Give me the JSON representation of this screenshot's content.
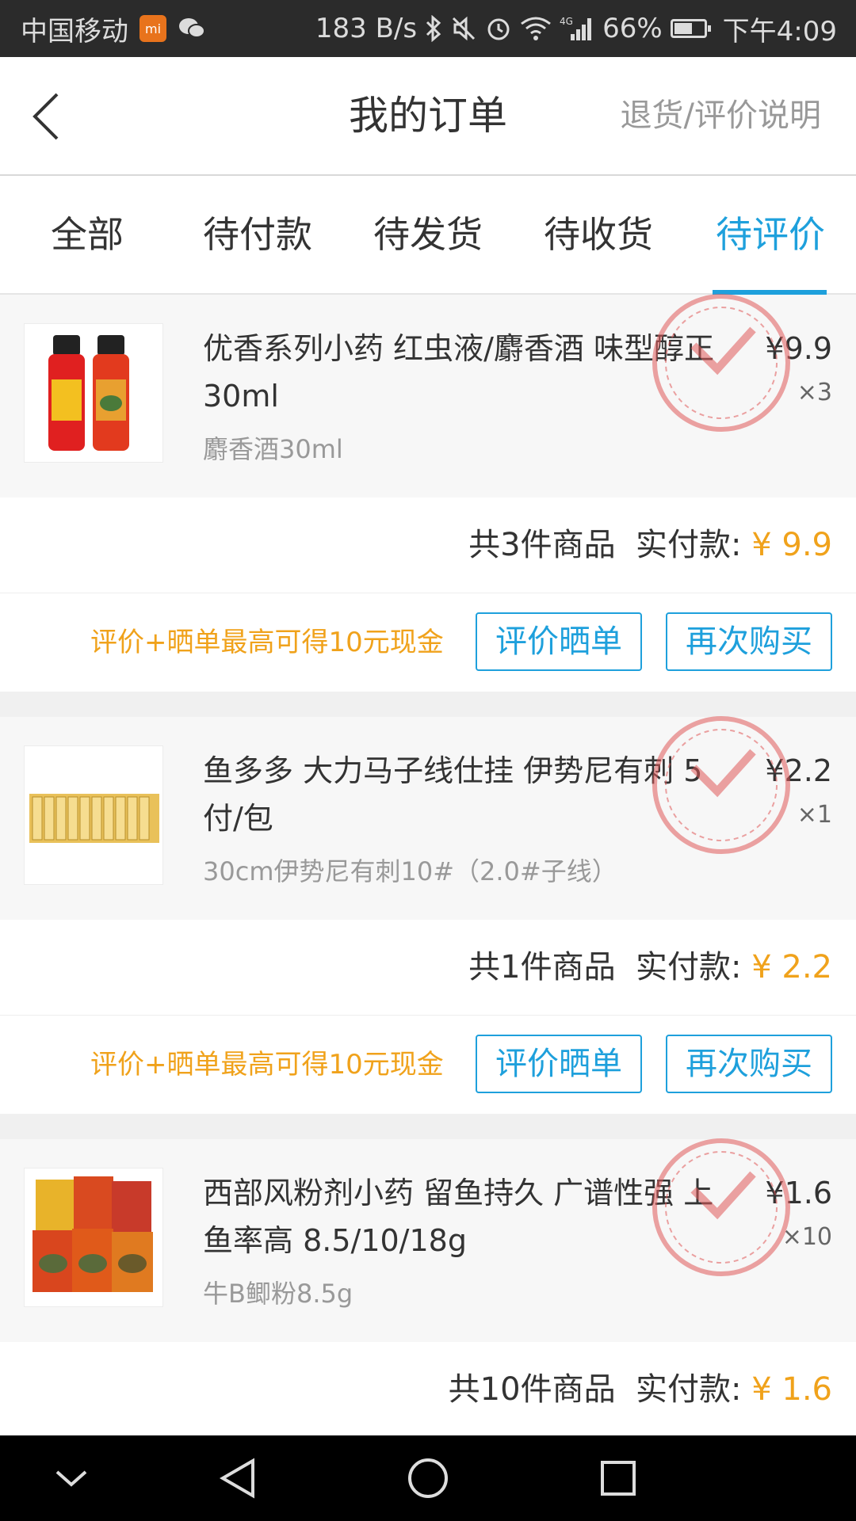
{
  "status_bar": {
    "carrier": "中国移动",
    "speed": "183 B/s",
    "network": "4G",
    "battery": "66%",
    "battery_level": 0.66,
    "time": "下午4:09"
  },
  "header": {
    "title": "我的订单",
    "link": "退货/评价说明"
  },
  "tabs": [
    {
      "label": "全部",
      "active": false
    },
    {
      "label": "待付款",
      "active": false
    },
    {
      "label": "待发货",
      "active": false
    },
    {
      "label": "待收货",
      "active": false
    },
    {
      "label": "待评价",
      "active": true
    }
  ],
  "orders": [
    {
      "title": "优香系列小药 红虫液/麝香酒 味型醇正 30ml",
      "spec": "麝香酒30ml",
      "price": "¥9.9",
      "qty": "×3",
      "summary_count": "共3件商品",
      "summary_label": "实付款:",
      "summary_amount": "¥ 9.9",
      "promo": "评价+晒单最高可得10元现金",
      "review_button": "评价晒单",
      "rebuy_button": "再次购买"
    },
    {
      "title": "鱼多多 大力马子线仕挂 伊势尼有刺 5付/包",
      "spec": "30cm伊势尼有刺10#（2.0#子线）",
      "price": "¥2.2",
      "qty": "×1",
      "summary_count": "共1件商品",
      "summary_label": "实付款:",
      "summary_amount": "¥ 2.2",
      "promo": "评价+晒单最高可得10元现金",
      "review_button": "评价晒单",
      "rebuy_button": "再次购买"
    },
    {
      "title": "西部风粉剂小药 留鱼持久 广谱性强 上鱼率高 8.5/10/18g",
      "spec": "牛B鲫粉8.5g",
      "price": "¥1.6",
      "qty": "×10",
      "summary_count": "共10件商品",
      "summary_label": "实付款:",
      "summary_amount": "¥ 1.6"
    }
  ],
  "colors": {
    "accent": "#1ea0dc",
    "price_orange": "#f0a21b",
    "stamp_red": "#e05a5a"
  }
}
